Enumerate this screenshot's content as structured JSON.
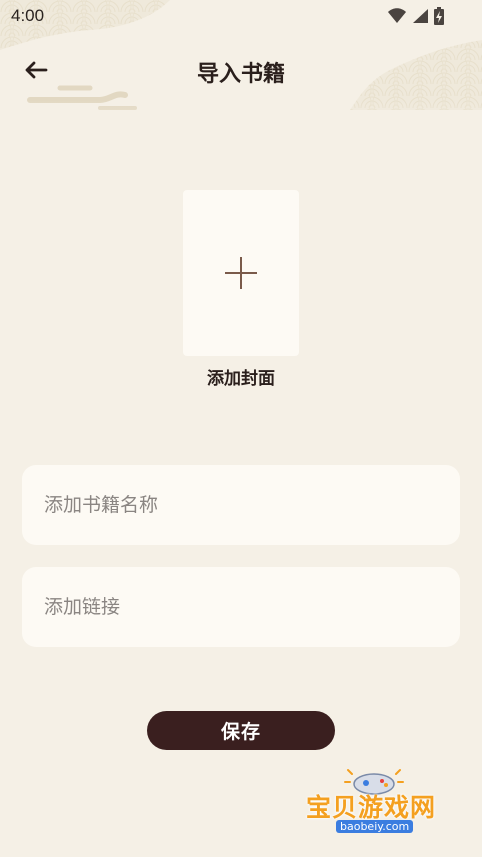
{
  "status_bar": {
    "time": "4:00",
    "icons": [
      "wifi-icon",
      "signal-icon",
      "battery-icon"
    ]
  },
  "appbar": {
    "back_icon": "arrow-left-icon",
    "title": "导入书籍"
  },
  "cover": {
    "add_icon": "plus-icon",
    "label": "添加封面"
  },
  "form": {
    "name_value": "",
    "name_placeholder": "添加书籍名称",
    "link_value": "",
    "link_placeholder": "添加链接"
  },
  "actions": {
    "save_label": "保存"
  },
  "watermark": {
    "text": "宝贝游戏网",
    "url": "baobeiy.com"
  },
  "colors": {
    "background": "#f5f0e6",
    "card": "#fdfaf4",
    "primary_button": "#3a1f1f",
    "title_text": "#2a1f1c",
    "placeholder_text": "#8a8582"
  }
}
